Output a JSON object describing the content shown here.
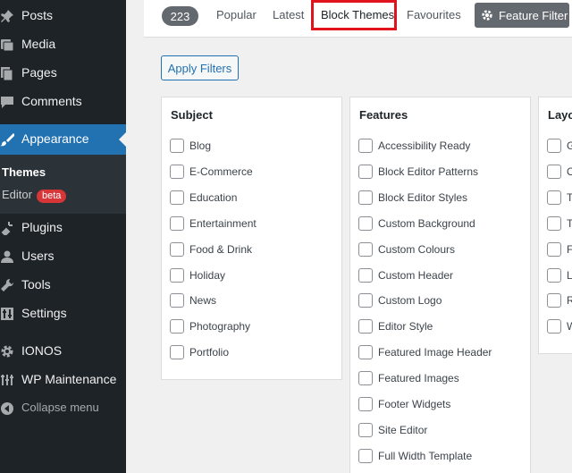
{
  "sidebar": {
    "items": [
      {
        "label": "Posts",
        "icon": "pin-icon"
      },
      {
        "label": "Media",
        "icon": "media-icon"
      },
      {
        "label": "Pages",
        "icon": "pages-icon"
      },
      {
        "label": "Comments",
        "icon": "comment-icon"
      },
      {
        "label": "Appearance",
        "icon": "brush-icon"
      },
      {
        "label": "Plugins",
        "icon": "plug-icon"
      },
      {
        "label": "Users",
        "icon": "user-icon"
      },
      {
        "label": "Tools",
        "icon": "wrench-icon"
      },
      {
        "label": "Settings",
        "icon": "sliders-icon"
      },
      {
        "label": "IONOS",
        "icon": "gear-icon"
      },
      {
        "label": "WP Maintenance",
        "icon": "tools-icon"
      },
      {
        "label": "Collapse menu",
        "icon": "collapse-arrow-icon"
      }
    ],
    "submenu": {
      "themes": "Themes",
      "editor": "Editor",
      "beta": "beta"
    }
  },
  "filter_bar": {
    "count": "223",
    "tabs": [
      "Popular",
      "Latest",
      "Block Themes",
      "Favourites"
    ],
    "feature_filter": "Feature Filter"
  },
  "apply_filters": "Apply Filters",
  "panels": {
    "subject": {
      "title": "Subject",
      "options": [
        "Blog",
        "E-Commerce",
        "Education",
        "Entertainment",
        "Food & Drink",
        "Holiday",
        "News",
        "Photography",
        "Portfolio"
      ]
    },
    "features": {
      "title": "Features",
      "options": [
        "Accessibility Ready",
        "Block Editor Patterns",
        "Block Editor Styles",
        "Custom Background",
        "Custom Colours",
        "Custom Header",
        "Custom Logo",
        "Editor Style",
        "Featured Image Header",
        "Featured Images",
        "Footer Widgets",
        "Site Editor",
        "Full Width Template"
      ]
    },
    "layout": {
      "title": "Layout",
      "options": [
        "G",
        "O",
        "T",
        "T",
        "F",
        "L",
        "R",
        "W"
      ]
    }
  },
  "colors": {
    "accent": "#2271b1",
    "sidebar_bg": "#1d2327",
    "highlight": "#e0121c",
    "badge": "#d63638"
  }
}
